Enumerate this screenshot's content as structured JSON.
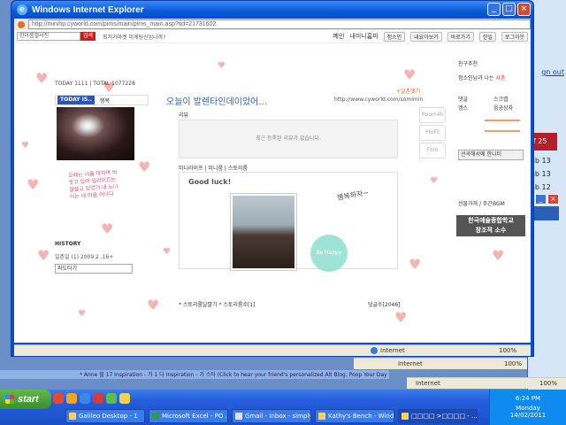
{
  "window": {
    "title": "Windows Internet Explorer",
    "url": "http://minihp.cyworld.com/pims/main/pims_main.asp?tid=21731602"
  },
  "topbar": {
    "search_placeholder": "한아름앨사진",
    "search_button": "검색",
    "tagline": "최저가마켓 미케팅신입나까?",
    "menu": [
      "메인",
      "내미니홈피",
      "정소인",
      "내요아보기",
      "바로가기",
      "한일",
      "로그아웃"
    ]
  },
  "hompy": {
    "today_line": "TODAY 1111 | TOTAL 1077228",
    "today_is_label": "TODAY IS..",
    "mood": "행복",
    "handwriting": "요때는 너를 마자며 비웃고 있어 일라이트는 잘살고 있었거 내 노나이는 내 마음 어나다",
    "history_label": "HISTORY",
    "history_text": "일촌일 (1) 2009.2 .16+",
    "pado_select": "파도타기",
    "main_title": "오늘이 발렌타인데이었어...",
    "follow_label": "+일촌맺기",
    "main_url": "http://www.cyworld.com/somimin",
    "review_label": "리뷰",
    "review_empty": "최근 등록된 리뷰가 없습니다.",
    "media_tabs": "미니라이프 | 미니룸 | 스토리룸",
    "goodluck": "Good luck!",
    "behappy": "Be Happy",
    "hangul_art": "행복하자~",
    "media_footer_left": "* 스토리룸달팔기 * 스토리룸수[1]",
    "media_footer_right": "덧글수[2046]",
    "side_tabs": [
      "Room4h",
      "ProFil",
      "Foto"
    ]
  },
  "right_panel": {
    "recommend": "친구추천",
    "friend_name": "정소인님과 나는",
    "friend_badge": "사촌",
    "stat1": "댓글",
    "stat2": "스크랩",
    "stat3": "엠스",
    "stat4": "음공상자",
    "player_text": "선곡해서에 한니티",
    "bgm_label": "선물가게 / 주간BGM",
    "banner_line1": "한국예술종합학교",
    "banner_line2": "창조적 소수"
  },
  "ie_status": {
    "zone": "Internet",
    "zoom": "100%"
  },
  "background": {
    "link_text": "gn out",
    "red_text": "of 25",
    "nums": [
      "ab 13",
      "ab 13",
      "ab 12"
    ],
    "behind_text": "* Anne 할 17  Inspiration  - 가 1 다  Inspiration  - 가 스타  (Click to hear your friend's personalized Alt Blog.  Poop Your Day"
  },
  "taskbar": {
    "start": "start",
    "tasks": [
      "Galileo Desktop - 1",
      "Microsoft Excel - PO ...",
      "Gmail - Inbox - simply...",
      "Kathy's Bench - Wind...",
      "□□□□ >□□□□ - ..."
    ],
    "time": "6:24 PM",
    "day": "Monday",
    "date": "14/02/2011"
  },
  "colors": {
    "title_bar": "#0a56d8",
    "accent_blue": "#2b5fd1",
    "heart_pink": "#f4b4b4",
    "start_green": "#3a8f2c"
  }
}
